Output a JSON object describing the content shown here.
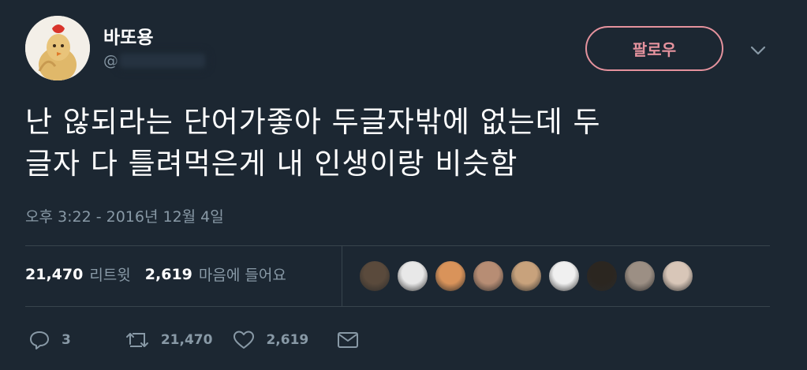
{
  "user": {
    "display_name": "바또용",
    "handle_prefix": "@"
  },
  "follow_button": {
    "label": "팔로우",
    "color": "#e4929d"
  },
  "tweet": {
    "line1": "난 않되라는 단어가좋아 두글자밖에 없는데 두",
    "line2": "글자 다 틀려먹은게 내 인생이랑 비슷함",
    "timestamp": "오후 3:22 - 2016년 12월 4일"
  },
  "stats": {
    "retweets_count": "21,470",
    "retweets_label": "리트윗",
    "likes_count": "2,619",
    "likes_label": "마음에 들어요"
  },
  "liker_avatars": [
    {
      "name": "liker-avatar-1",
      "color": "#5a4a3c"
    },
    {
      "name": "liker-avatar-2",
      "color": "#e8e8e8"
    },
    {
      "name": "liker-avatar-3",
      "color": "#d9935a"
    },
    {
      "name": "liker-avatar-4",
      "color": "#b78d74"
    },
    {
      "name": "liker-avatar-5",
      "color": "#c8a27c"
    },
    {
      "name": "liker-avatar-6",
      "color": "#f0f0f0"
    },
    {
      "name": "liker-avatar-7",
      "color": "#2b2620"
    },
    {
      "name": "liker-avatar-8",
      "color": "#9c8f84"
    },
    {
      "name": "liker-avatar-9",
      "color": "#d8c6b8"
    }
  ],
  "actions": {
    "reply_count": "3",
    "retweet_count": "21,470",
    "like_count": "2,619"
  },
  "colors": {
    "background": "#1c2732",
    "secondary_text": "#8899a6",
    "divider": "#38444d"
  }
}
